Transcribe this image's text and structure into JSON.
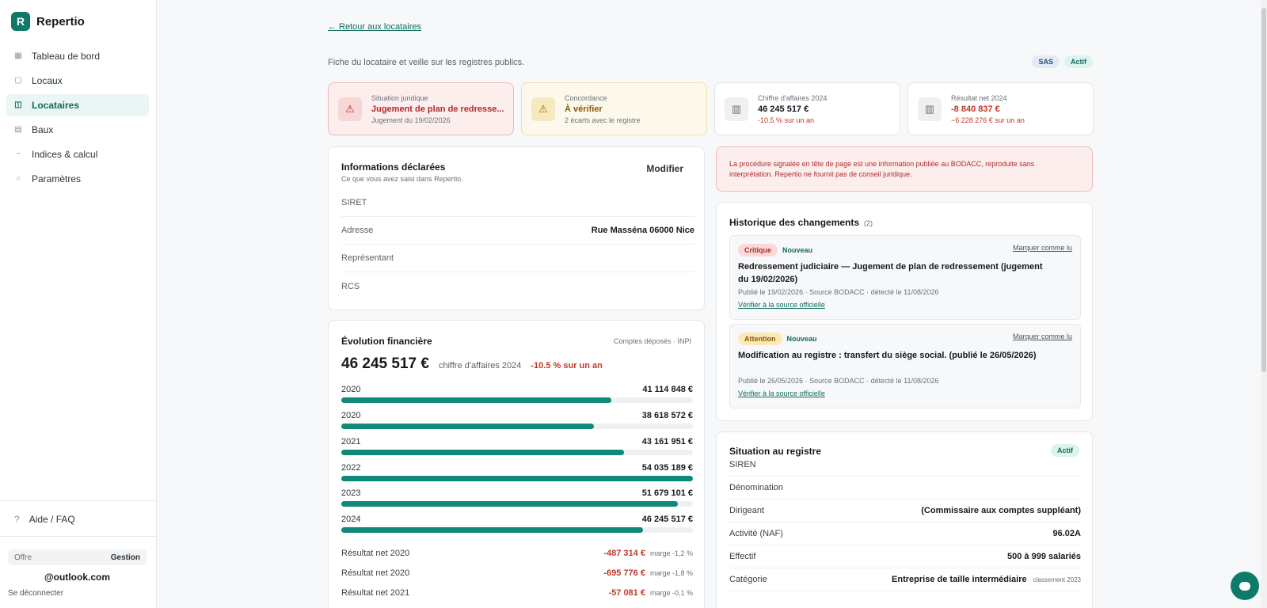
{
  "brand": {
    "logo_letter": "R",
    "name": "Repertio"
  },
  "sidebar": {
    "items": [
      {
        "label": "Tableau de bord",
        "icon": "grid-icon"
      },
      {
        "label": "Locaux",
        "icon": "square-icon"
      },
      {
        "label": "Locataires",
        "icon": "columns-icon",
        "active": true
      },
      {
        "label": "Baux",
        "icon": "list-icon"
      },
      {
        "label": "Indices & calcul",
        "icon": "wave-icon"
      },
      {
        "label": "Paramètres",
        "icon": "circle-icon"
      }
    ],
    "help_icon": "?",
    "help_label": "Aide / FAQ",
    "plan_label": "Offre",
    "plan_value": "Gestion",
    "email": "@outlook.com",
    "logout": "Se déconnecter"
  },
  "header": {
    "back_link": "← Retour aux locataires",
    "subtitle": "Fiche du locataire et veille sur les registres publics.",
    "badge_form": "SAS",
    "badge_status": "Actif"
  },
  "kpis": {
    "legal": {
      "label": "Situation juridique",
      "value": "Jugement de plan de redresse...",
      "sub": "Jugement du 19/02/2026"
    },
    "match": {
      "label": "Concordance",
      "value": "À vérifier",
      "sub": "2 écarts avec le registre"
    },
    "revenue": {
      "label": "Chiffre d'affaires 2024",
      "value": "46 245 517 €",
      "sub": "-10.5 % sur un an"
    },
    "net": {
      "label": "Résultat net 2024",
      "value": "-8 840 837 €",
      "sub": "−6 228 276 € sur un an"
    }
  },
  "info": {
    "title": "Informations déclarées",
    "subtitle": "Ce que vous avez saisi dans Repertio.",
    "modify": "Modifier",
    "rows": [
      {
        "label": "SIRET",
        "value": ""
      },
      {
        "label": "Adresse",
        "value": "Rue Masséna 06000 Nice"
      },
      {
        "label": "Représentant",
        "value": ""
      },
      {
        "label": "RCS",
        "value": ""
      }
    ]
  },
  "finance": {
    "title": "Évolution financière",
    "source": "Comptes déposés · INPI",
    "big_value": "46 245 517 €",
    "big_label": "chiffre d'affaires 2024",
    "big_delta": "-10.5 % sur un an",
    "bars": [
      {
        "year": "2020",
        "amount": "41 114 848 €",
        "fill": 0.769
      },
      {
        "year": "2020",
        "amount": "38 618 572 €",
        "fill": 0.719
      },
      {
        "year": "2021",
        "amount": "43 161 951 €",
        "fill": 0.804
      },
      {
        "year": "2022",
        "amount": "54 035 189 €",
        "fill": 1.0
      },
      {
        "year": "2023",
        "amount": "51 679 101 €",
        "fill": 0.957
      },
      {
        "year": "2024",
        "amount": "46 245 517 €",
        "fill": 0.858
      }
    ],
    "net_rows": [
      {
        "label": "Résultat net 2020",
        "value": "-487 314 €",
        "margin": "marge -1,2 %"
      },
      {
        "label": "Résultat net 2020",
        "value": "-695 776 €",
        "margin": "marge -1,8 %"
      },
      {
        "label": "Résultat net 2021",
        "value": "-57 081 €",
        "margin": "marge -0,1 %"
      }
    ]
  },
  "alert": {
    "text": "La procédure signalée en tête de page est une information publiée au BODACC, reproduite sans interprétation. Repertio ne fournit pas de conseil juridique."
  },
  "history": {
    "title": "Historique des changements",
    "count": "(2)",
    "items": [
      {
        "severity": "Critique",
        "status": "Nouveau",
        "mark_read": "Marquer comme lu",
        "title": "Redressement judiciaire — Jugement de plan de redressement (jugement du 19/02/2026)",
        "meta": "Publié le 19/02/2026 · Source BODACC · détecté le 11/08/2026",
        "link": "Vérifier à la source officielle"
      },
      {
        "severity": "Attention",
        "status": "Nouveau",
        "mark_read": "Marquer comme lu",
        "title": "Modification au registre : transfert du siège social. (publié le 26/05/2026)",
        "meta": "Publié le 26/05/2026 · Source BODACC · détecté le 11/08/2026",
        "link": "Vérifier à la source officielle"
      }
    ]
  },
  "registry": {
    "title": "Situation au registre",
    "badge": "Actif",
    "rows": [
      {
        "label": "SIREN",
        "value": "",
        "extra": ""
      },
      {
        "label": "Dénomination",
        "value": "",
        "extra": ""
      },
      {
        "label": "Dirigeant",
        "value": "(Commissaire aux comptes suppléant)",
        "extra": ""
      },
      {
        "label": "Activité (NAF)",
        "value": "96.02A",
        "extra": ""
      },
      {
        "label": "Effectif",
        "value": "500 à 999 salariés",
        "extra": ""
      },
      {
        "label": "Catégorie",
        "value": "Entreprise de taille intermédiaire",
        "extra": "· classement 2023"
      }
    ]
  },
  "colors": {
    "brand": "#0f7a6a",
    "bar": "#11897a",
    "danger": "#b02a2a",
    "warning": "#8a5a00"
  }
}
